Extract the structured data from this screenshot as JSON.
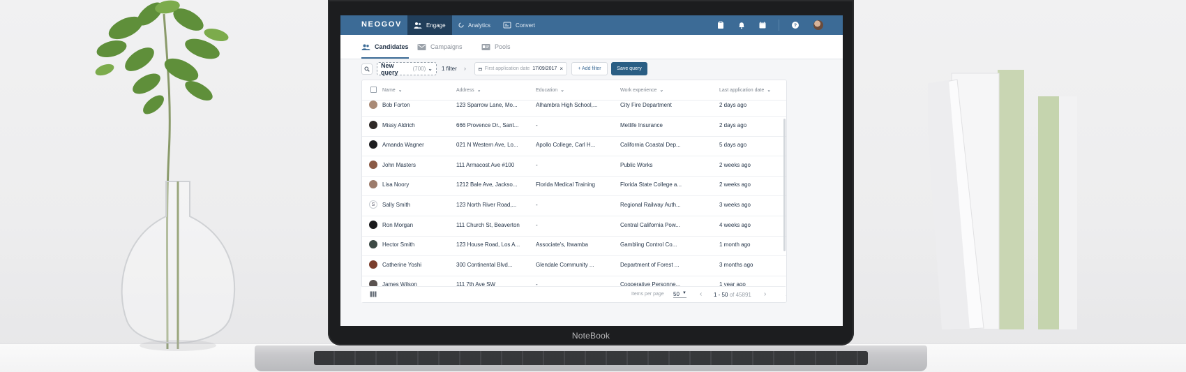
{
  "app": {
    "brand": "NEOGOV",
    "nav": [
      {
        "label": "Engage",
        "icon": "people-icon",
        "active": true
      },
      {
        "label": "Analytics",
        "icon": "analytics-icon",
        "active": false
      },
      {
        "label": "Convert",
        "icon": "convert-icon",
        "active": false
      }
    ],
    "topbar_icons": [
      "clipboard-icon",
      "bell-icon",
      "calendar-icon",
      "help-icon"
    ]
  },
  "subnav": {
    "tabs": [
      {
        "label": "Candidates",
        "icon": "people-icon",
        "active": true
      },
      {
        "label": "Campaigns",
        "icon": "mail-icon",
        "active": false
      },
      {
        "label": "Pools",
        "icon": "id-card-icon",
        "active": false
      }
    ]
  },
  "filters": {
    "query_label": "New query",
    "query_count": "(700)",
    "filter_count": "1 filter",
    "chip_label": "First application date",
    "chip_value": "17/09/2017",
    "chip_remove": "×",
    "add_filter": "+ Add filter",
    "save_query": "Save query"
  },
  "table": {
    "columns": [
      "Name",
      "Address",
      "Education",
      "Work experience",
      "Last application date"
    ],
    "rows": [
      {
        "avatar": "photo",
        "color": "#a98a76",
        "name": "Bob Forton",
        "address": "123 Sparrow Lane, Mo...",
        "education": "Alhambra High School,...",
        "work": "City Fire Department",
        "date": "2 days ago"
      },
      {
        "avatar": "photo",
        "color": "#2f2a28",
        "name": "Missy Aldrich",
        "address": "666 Provence Dr., Sant...",
        "education": "-",
        "work": "Metlife Insurance",
        "date": "2 days ago"
      },
      {
        "avatar": "photo",
        "color": "#1e1e20",
        "name": "Amanda Wagner",
        "address": "021 N Western Ave, Lo...",
        "education": "Apollo College, Carl H...",
        "work": "California Coastal Dep...",
        "date": "5 days ago"
      },
      {
        "avatar": "photo",
        "color": "#8a5a45",
        "name": "John Masters",
        "address": "111 Armacost Ave #100",
        "education": "-",
        "work": "Public Works",
        "date": "2 weeks ago"
      },
      {
        "avatar": "photo",
        "color": "#9c7b6b",
        "name": "Lisa Noory",
        "address": "1212 Bale Ave, Jackso...",
        "education": "Florida Medical Training",
        "work": "Florida State College a...",
        "date": "2 weeks ago"
      },
      {
        "avatar": "initial",
        "initial": "S",
        "name": "Sally Smith",
        "address": "123 North River Road,...",
        "education": "-",
        "work": "Regional Railway Auth...",
        "date": "3 weeks ago"
      },
      {
        "avatar": "photo",
        "color": "#1a1a1c",
        "name": "Ron Morgan",
        "address": "111 Church St, Beaverton",
        "education": "-",
        "work": "Central California Pow...",
        "date": "4 weeks ago"
      },
      {
        "avatar": "photo",
        "color": "#3d4a45",
        "name": "Hector Smith",
        "address": "123 House Road, Los A...",
        "education": "Associate's, Itwamba",
        "work": "Gambling Control Co...",
        "date": "1 month ago"
      },
      {
        "avatar": "photo",
        "color": "#7a3d2c",
        "name": "Catherine Yoshi",
        "address": "300 Continental Blvd...",
        "education": "Glendale Community ...",
        "work": "Department of Forest ...",
        "date": "3 months ago"
      },
      {
        "avatar": "photo",
        "color": "#5a5250",
        "name": "James Wilson",
        "address": "111 7th Ave SW",
        "education": "-",
        "work": "Cooperative Personne...",
        "date": "1 year ago"
      }
    ]
  },
  "pagination": {
    "items_per_page_label": "Items per page",
    "items_per_page": "50",
    "range": "1 - 50",
    "of_total": "of 45891"
  },
  "device": {
    "label": "NoteBook"
  }
}
